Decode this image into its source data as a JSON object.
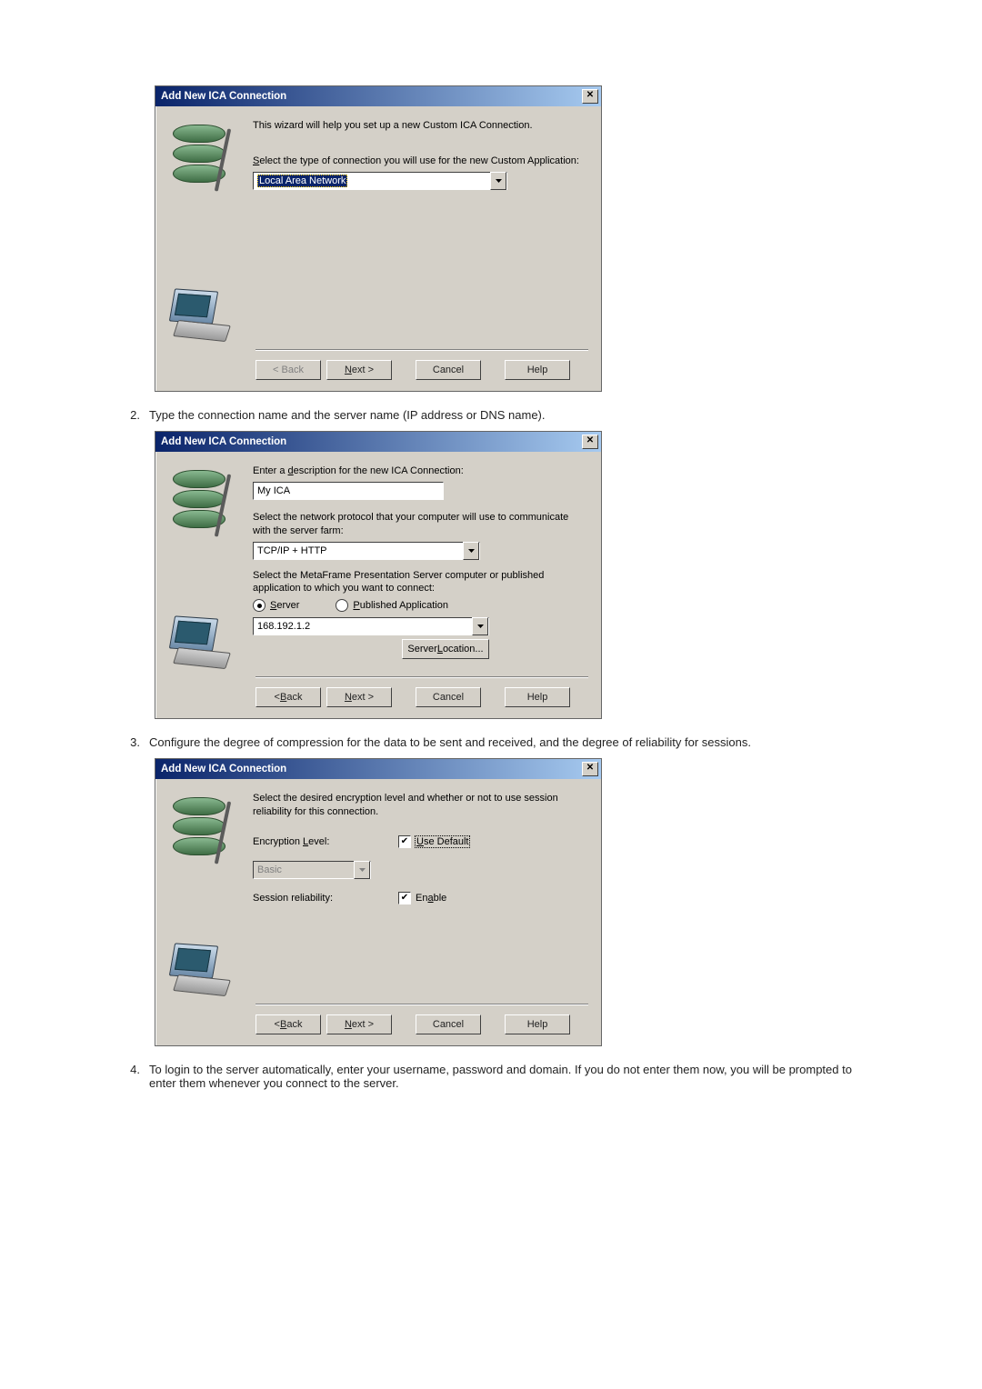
{
  "shared": {
    "dialog_title": "Add New ICA Connection",
    "back_label": "< Back",
    "next_label": "Next >",
    "cancel_label": "Cancel",
    "help_label": "Help"
  },
  "dialog1": {
    "intro": "This wizard will help you set up a new Custom ICA Connection.",
    "select_type_label": "Select the type of connection you will use for the new Custom Application:",
    "connection_type_value": "Local Area Network"
  },
  "step2": {
    "number": "2.",
    "text": "Type the connection name and the server name (IP address or DNS name)."
  },
  "dialog2": {
    "desc_label": "Enter a description for the new ICA Connection:",
    "desc_value": "My ICA",
    "protocol_label": "Select the network protocol that your computer will use to communicate with the server farm:",
    "protocol_value": "TCP/IP + HTTP",
    "serverapp_label": "Select the MetaFrame Presentation Server computer or published application to which you want to connect:",
    "radio_server": "Server",
    "radio_pubapp": "Published Application",
    "server_value": "168.192.1.2",
    "server_location_btn": "Server Location..."
  },
  "step3": {
    "number": "3.",
    "text": "Configure the degree of compression for the data to be sent and received, and the degree of reliability for sessions."
  },
  "dialog3": {
    "intro": "Select the desired encryption level and whether or not to use session reliability for this connection.",
    "encryption_level_label": "Encryption Level:",
    "use_default": "Use Default",
    "encryption_value": "Basic",
    "session_reliability_label": "Session reliability:",
    "enable": "Enable"
  },
  "step4": {
    "number": "4.",
    "text": "To login to the server automatically, enter your username, password and domain. If you do not enter them now, you will be prompted to enter them whenever you connect to the server."
  }
}
